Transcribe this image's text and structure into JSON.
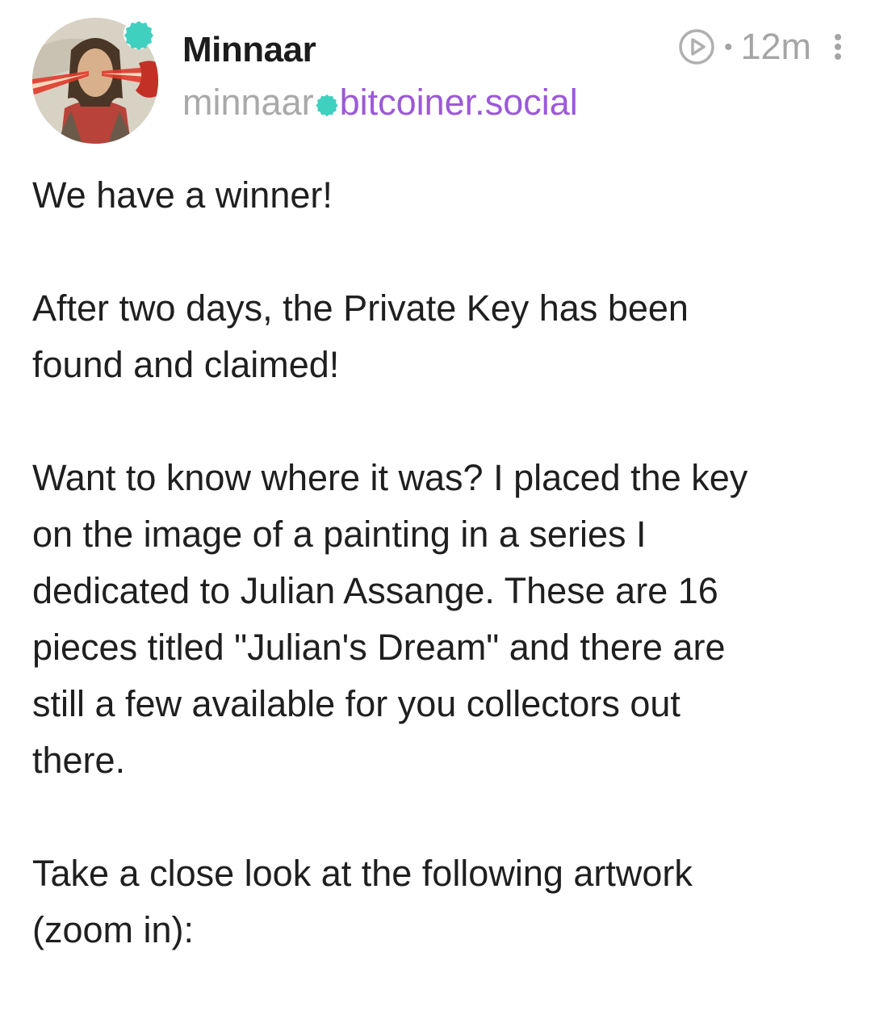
{
  "post": {
    "author": {
      "display_name": "Minnaar",
      "username": "minnaar",
      "domain": "bitcoiner.social",
      "avatar": "laser-eyes-portrait",
      "badge_color": "#3fd0c0"
    },
    "meta": {
      "time_ago": "12m",
      "play_icon": "play-circle-icon",
      "more_icon": "more-vertical-icon"
    },
    "paragraphs": [
      "We have a winner!",
      "After two days, the Private Key has been\nfound and claimed!",
      "Want to know where it was? I placed the key\non the image of a painting in a series I\ndedicated to Julian Assange. These are 16\npieces titled \"Julian's Dream\" and there are\nstill a few available for you collectors out\nthere.",
      "Take a close look at the following artwork\n(zoom in):"
    ]
  },
  "colors": {
    "handle_user": "#a9a9a9",
    "handle_domain": "#9b59d8",
    "text": "#1f1f1f",
    "meta": "#a5a5a5"
  }
}
